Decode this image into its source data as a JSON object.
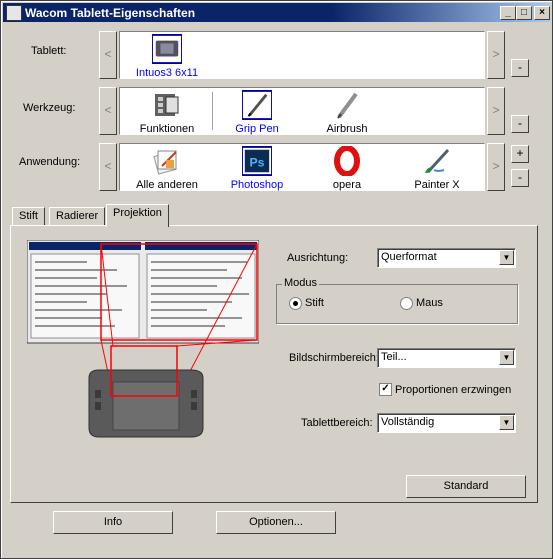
{
  "window": {
    "title": "Wacom Tablett-Eigenschaften"
  },
  "rows": {
    "tablet": {
      "label": "Tablett:",
      "items": [
        {
          "label": "Intuos3 6x11",
          "icon": "tablet-icon",
          "selected": true
        }
      ]
    },
    "tool": {
      "label": "Werkzeug:",
      "items": [
        {
          "label": "Funktionen",
          "icon": "functions-icon",
          "selected": false
        },
        {
          "label": "Grip Pen",
          "icon": "pen-icon",
          "selected": true
        },
        {
          "label": "Airbrush",
          "icon": "airbrush-icon",
          "selected": false
        }
      ]
    },
    "app": {
      "label": "Anwendung:",
      "items": [
        {
          "label": "Alle anderen",
          "icon": "all-apps-icon",
          "selected": false
        },
        {
          "label": "Photoshop",
          "icon": "photoshop-icon",
          "selected": true
        },
        {
          "label": "opera",
          "icon": "opera-icon",
          "selected": false
        },
        {
          "label": "Painter X",
          "icon": "painter-icon",
          "selected": false
        }
      ]
    }
  },
  "nav": {
    "left": "<",
    "right": ">",
    "add": "+",
    "remove": "-"
  },
  "tabs": [
    {
      "label": "Stift",
      "active": false
    },
    {
      "label": "Radierer",
      "active": false
    },
    {
      "label": "Projektion",
      "active": true
    }
  ],
  "projection": {
    "orientation_label": "Ausrichtung:",
    "orientation_value": "Querformat",
    "mode_label": "Modus",
    "mode_pen": "Stift",
    "mode_mouse": "Maus",
    "mode_selected": "pen",
    "screen_area_label": "Bildschirmbereich:",
    "screen_area_value": "Teil...",
    "force_proportions_label": "Proportionen erzwingen",
    "force_proportions_checked": true,
    "tablet_area_label": "Tablettbereich:",
    "tablet_area_value": "Vollständig",
    "default_button": "Standard"
  },
  "footer": {
    "info_button": "Info",
    "options_button": "Optionen..."
  },
  "colors": {
    "selection": "#0000ff",
    "mapping": "#ff0000",
    "title_bar": "#0a246a"
  }
}
